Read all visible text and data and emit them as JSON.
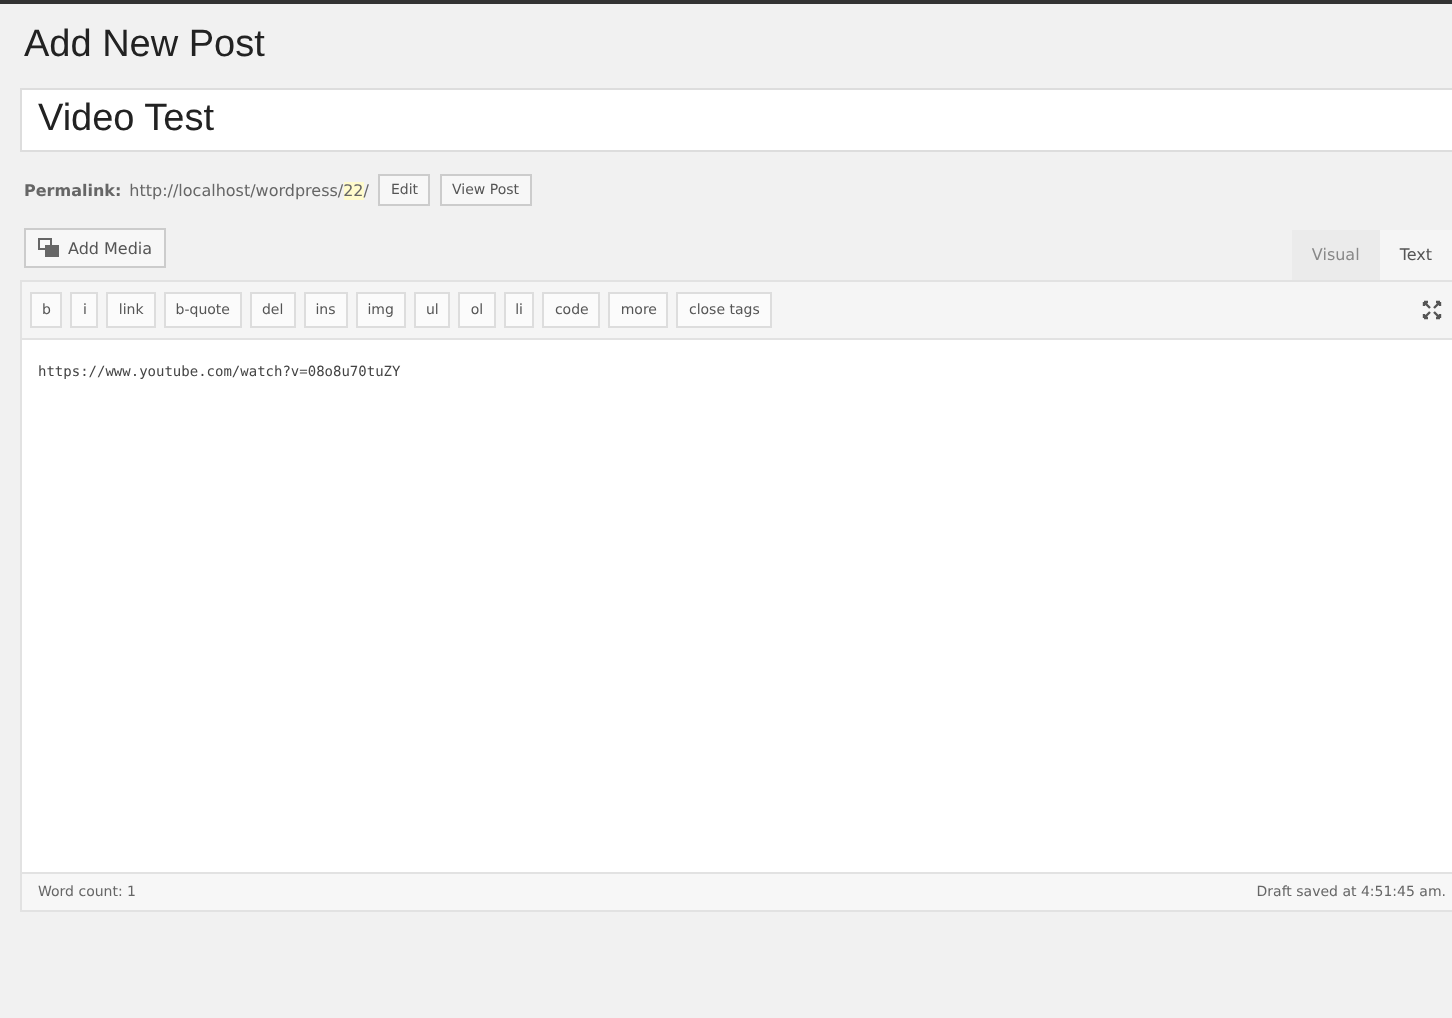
{
  "heading": "Add New Post",
  "title_field": {
    "value": "Video Test"
  },
  "permalink": {
    "label": "Permalink:",
    "base": "http://localhost/wordpress/",
    "slug": "22",
    "end": "/",
    "buttons": [
      "Edit",
      "View Post"
    ]
  },
  "add_media": "Add Media",
  "editor_tabs": [
    {
      "label": "Visual",
      "selected": false
    },
    {
      "label": "Text",
      "selected": true
    }
  ],
  "quicktags": [
    "b",
    "i",
    "link",
    "b-quote",
    "del",
    "ins",
    "img",
    "ul",
    "ol",
    "li",
    "code",
    "more",
    "close tags"
  ],
  "content": "https://www.youtube.com/watch?v=08o8u70tuZY",
  "status_bar": {
    "word_count": "Word count: 1",
    "draft_saved": "Draft saved at 4:51:45 am."
  }
}
